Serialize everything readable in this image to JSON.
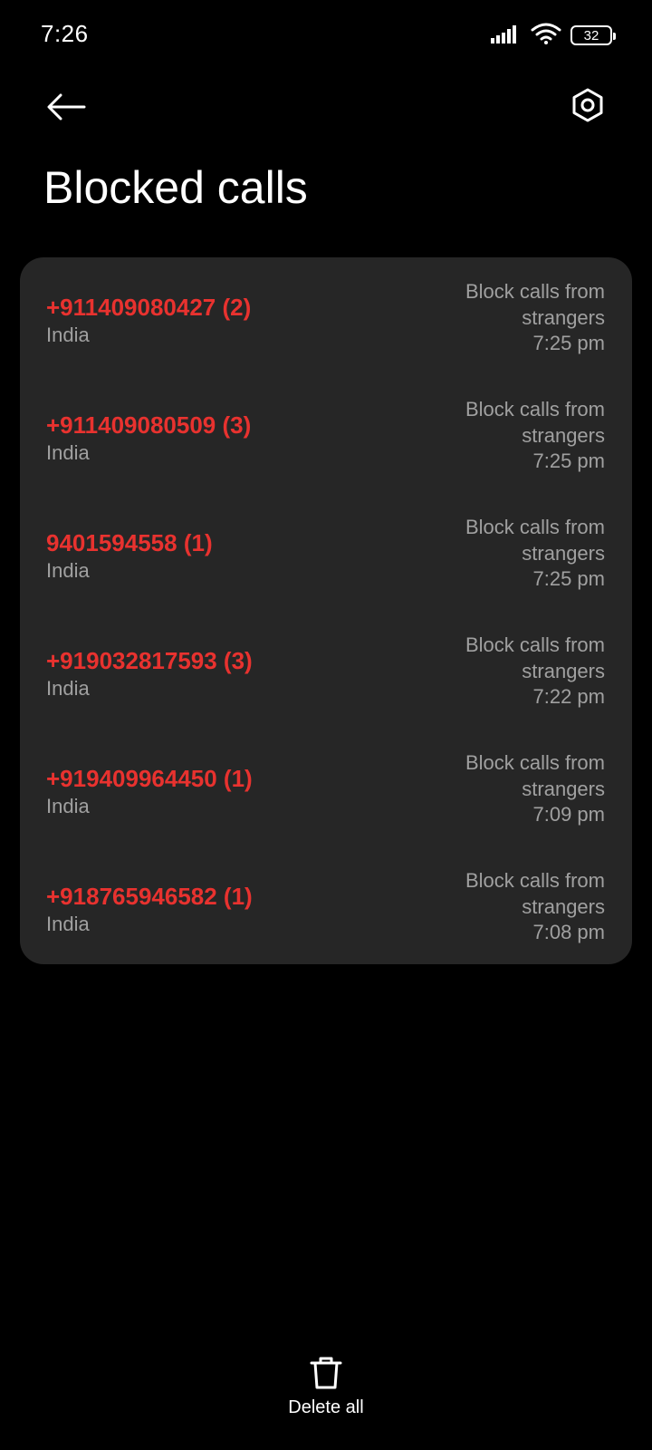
{
  "status_bar": {
    "time": "7:26",
    "battery_level": "32",
    "icons": [
      "signal-icon",
      "wifi-icon",
      "battery-icon"
    ]
  },
  "header": {
    "back_icon": "arrow-left-icon",
    "settings_icon": "hexagon-gear-icon",
    "title": "Blocked calls"
  },
  "blocked_calls": [
    {
      "number": "+911409080427 (2)",
      "country": "India",
      "reason": "Block calls from strangers",
      "time": "7:25 pm"
    },
    {
      "number": "+911409080509 (3)",
      "country": "India",
      "reason": "Block calls from strangers",
      "time": "7:25 pm"
    },
    {
      "number": "9401594558 (1)",
      "country": "India",
      "reason": "Block calls from strangers",
      "time": "7:25 pm"
    },
    {
      "number": "+919032817593 (3)",
      "country": "India",
      "reason": "Block calls from strangers",
      "time": "7:22 pm"
    },
    {
      "number": "+919409964450 (1)",
      "country": "India",
      "reason": "Block calls from strangers",
      "time": "7:09 pm"
    },
    {
      "number": "+918765946582 (1)",
      "country": "India",
      "reason": "Block calls from strangers",
      "time": "7:08 pm"
    }
  ],
  "footer": {
    "delete_all_label": "Delete all",
    "delete_icon": "trash-icon"
  },
  "colors": {
    "background": "#000000",
    "card": "#262626",
    "number_red": "#e8322f",
    "secondary_text": "#a0a0a0"
  }
}
